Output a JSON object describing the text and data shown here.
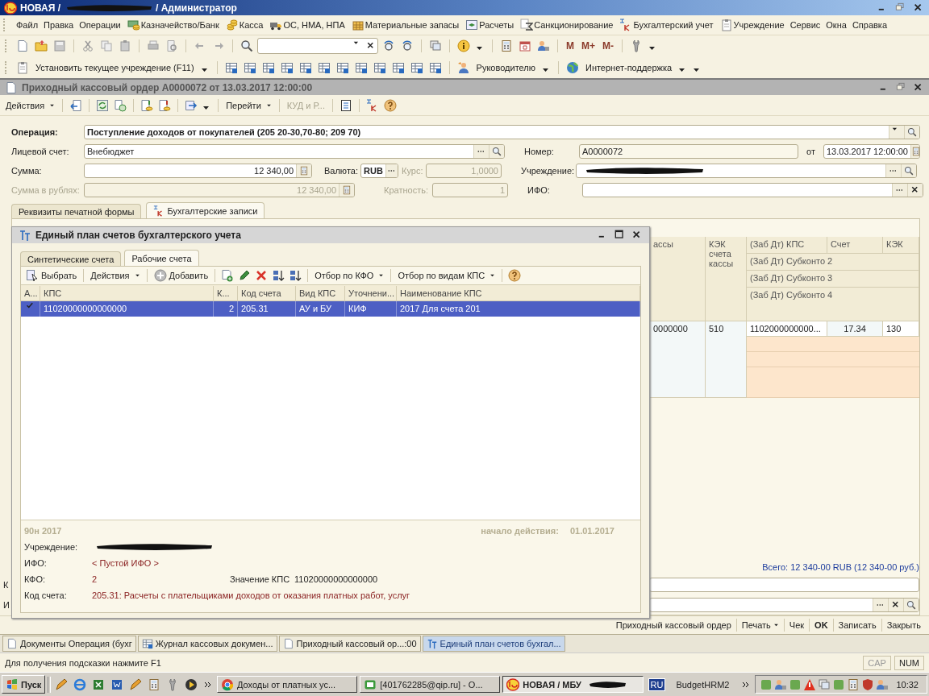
{
  "app_window": {
    "title_start": "НОВАЯ /",
    "title_end": "/ Администратор"
  },
  "menu": [
    {
      "label": "Файл"
    },
    {
      "label": "Правка"
    },
    {
      "label": "Операции"
    },
    {
      "label": "Казначейство/Банк"
    },
    {
      "label": "Касса"
    },
    {
      "label": "ОС, НМА, НПА"
    },
    {
      "label": "Материальные запасы"
    },
    {
      "label": "Расчеты"
    },
    {
      "label": "Санкционирование"
    },
    {
      "label": "Бухгалтерский учет"
    },
    {
      "label": "Учреждение"
    },
    {
      "label": "Сервис"
    },
    {
      "label": "Окна"
    },
    {
      "label": "Справка"
    }
  ],
  "memory_buttons": [
    "M",
    "M+",
    "M-"
  ],
  "toolbar2": {
    "set_institution": "Установить текущее учреждение (F11)",
    "manager": "Руководителю",
    "support": "Интернет-поддержка"
  },
  "document": {
    "title": "Приходный кассовый ордер А0000072 от 13.03.2017 12:00:00",
    "actions": [
      {
        "label": "Действия",
        "kind": "menu",
        "disabled": false
      },
      {
        "label": "Перейти",
        "kind": "menu",
        "disabled": false
      },
      {
        "label": "КУД и Р...",
        "kind": "button",
        "disabled": true
      }
    ],
    "operation": {
      "label": "Операция:",
      "value": "Поступление доходов от покупателей (205 20-30,70-80; 209 70)"
    },
    "account": {
      "label": "Лицевой счет:",
      "value": "Внебюджет"
    },
    "number": {
      "label": "Номер:",
      "value": "А0000072"
    },
    "date": {
      "label": "от",
      "value": "13.03.2017 12:00:00"
    },
    "sum": {
      "label": "Сумма:",
      "value": "12 340,00",
      "disabled": false
    },
    "currency": {
      "label": "Валюта:",
      "value": "RUB"
    },
    "rate": {
      "label": "Курс:",
      "value": "1,0000",
      "disabled": true
    },
    "institution": {
      "label": "Учреждение:"
    },
    "sum_rub": {
      "label": "Сумма в рублях:",
      "value": "12 340,00",
      "disabled": true
    },
    "multiplicity": {
      "label": "Кратность:",
      "value": "1",
      "disabled": true
    },
    "ifo": {
      "label": "ИФО:"
    },
    "tabs": [
      {
        "label": "Реквизиты печатной формы",
        "selected": false
      },
      {
        "label": "Бухгалтерские записи",
        "selected": true
      }
    ],
    "entries": {
      "headers": [
        "ассы",
        "КЭК счета кассы",
        "(Заб Дт) КПС",
        "Счет",
        "КЭК",
        "(Заб Дт) Субконто 2",
        "(Заб Дт) Субконто 3",
        "(Заб Дт) Субконто 4"
      ],
      "row": [
        "0000000",
        "510",
        "1102000000000...",
        "17.34",
        "130"
      ]
    },
    "total": "Всего: 12 340-00 RUB (12 340-00 руб.)",
    "cut_labels": [
      "К",
      "И"
    ],
    "footer": [
      {
        "label": "Приходный кассовый ордер",
        "kind": "button"
      },
      {
        "label": "Печать",
        "kind": "menu"
      },
      {
        "label": "Чек",
        "kind": "button"
      },
      {
        "label": "OK",
        "kind": "default"
      },
      {
        "label": "Записать",
        "kind": "button"
      },
      {
        "label": "Закрыть",
        "kind": "button"
      }
    ]
  },
  "dialog": {
    "title": "Единый план счетов бухгалтерского учета",
    "tabs": [
      {
        "label": "Синтетические счета",
        "selected": false
      },
      {
        "label": "Рабочие счета",
        "selected": true
      }
    ],
    "toolbar": [
      {
        "label": "Выбрать",
        "kind": "select"
      },
      {
        "label": "Действия",
        "kind": "menu"
      },
      {
        "label": "Добавить",
        "kind": "add"
      },
      {
        "label": "Отбор по КФО",
        "kind": "menu"
      },
      {
        "label": "Отбор по видам КПС",
        "kind": "menu"
      }
    ],
    "columns": [
      "А...",
      "КПС",
      "К...",
      "Код счета",
      "Вид КПС",
      "Уточнени...",
      "Наименование КПС"
    ],
    "rows": [
      {
        "selected": true,
        "active": true,
        "cells": [
          "",
          "11020000000000000",
          "2",
          "205.31",
          "АУ и БУ",
          "КИФ",
          "2017 Для счета 201"
        ]
      }
    ],
    "info": {
      "order": "90н 2017",
      "start_label": "начало действия:",
      "start_date": "01.01.2017",
      "institution_label": "Учреждение:",
      "ifo_label": "ИФО:",
      "ifo_value": "< Пустой ИФО >",
      "kfo_label": "КФО:",
      "kfo_value": "2",
      "kps_label": "Значение КПС",
      "kps_value": "11020000000000000",
      "account_label": "Код счета:",
      "account_value": "205.31: Расчеты с плательщиками доходов от оказания платных работ, услуг"
    }
  },
  "window_tabs": [
    {
      "label": "Документы Операция (бухг",
      "selected": false
    },
    {
      "label": "Журнал кассовых докумен...",
      "selected": false
    },
    {
      "label": "Приходный кассовый ор...:00",
      "selected": false
    },
    {
      "label": "Единый план счетов бухгал...",
      "selected": true
    }
  ],
  "status_bar": {
    "hint": "Для получения подсказки нажмите F1",
    "indicators": [
      {
        "label": "CAP",
        "on": false
      },
      {
        "label": "NUM",
        "on": true
      }
    ]
  },
  "taskbar": {
    "start": "Пуск",
    "tasks": [
      {
        "label": "Доходы от платных ус...",
        "selected": false
      },
      {
        "label": "[401762285@qip.ru] - О...",
        "selected": false
      },
      {
        "label": "НОВАЯ / МБУ",
        "selected": true
      }
    ],
    "language": "RU",
    "toolbar_label": "BudgetHRM2",
    "clock": "10:32"
  }
}
